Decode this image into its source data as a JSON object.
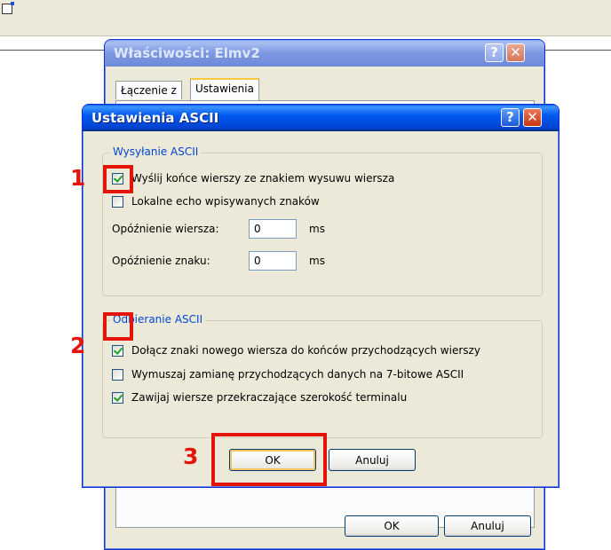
{
  "back_window": {
    "title": "Właściwości: Elmv2",
    "help_glyph": "?",
    "close_glyph": "✕",
    "tabs": [
      "Łączenie z",
      "Ustawienia"
    ],
    "ok_label": "OK",
    "cancel_label": "Anuluj"
  },
  "dialog": {
    "title": "Ustawienia ASCII",
    "help_glyph": "?",
    "close_glyph": "✕",
    "sending": {
      "legend": "Wysyłanie ASCII",
      "send_line_ends": {
        "label": "Wyślij końce wierszy ze znakiem wysuwu wiersza",
        "checked": true
      },
      "local_echo": {
        "label": "Lokalne echo wpisywanych znaków",
        "checked": false
      },
      "line_delay": {
        "label": "Opóźnienie wiersza:",
        "value": "0",
        "unit": "ms"
      },
      "char_delay": {
        "label": "Opóźnienie znaku:",
        "value": "0",
        "unit": "ms"
      }
    },
    "receiving": {
      "legend": "Odbieranie ASCII",
      "append_line_feeds": {
        "label": "Dołącz znaki nowego wiersza do końców przychodzących wierszy",
        "checked": true
      },
      "force_7bit": {
        "label": "Wymuszaj zamianę przychodzących danych na 7-bitowe ASCII",
        "checked": false
      },
      "wrap_lines": {
        "label": "Zawijaj wiersze przekraczające szerokość terminalu",
        "checked": true
      }
    },
    "ok_label": "OK",
    "cancel_label": "Anuluj"
  },
  "annotations": {
    "marker_1": "1",
    "marker_2": "2",
    "marker_3": "3",
    "color": "#e5140b"
  },
  "colors": {
    "title_bar": "#0058ee",
    "dialog_face": "#ece9d8",
    "groupbox_legend": "#0046d5"
  }
}
